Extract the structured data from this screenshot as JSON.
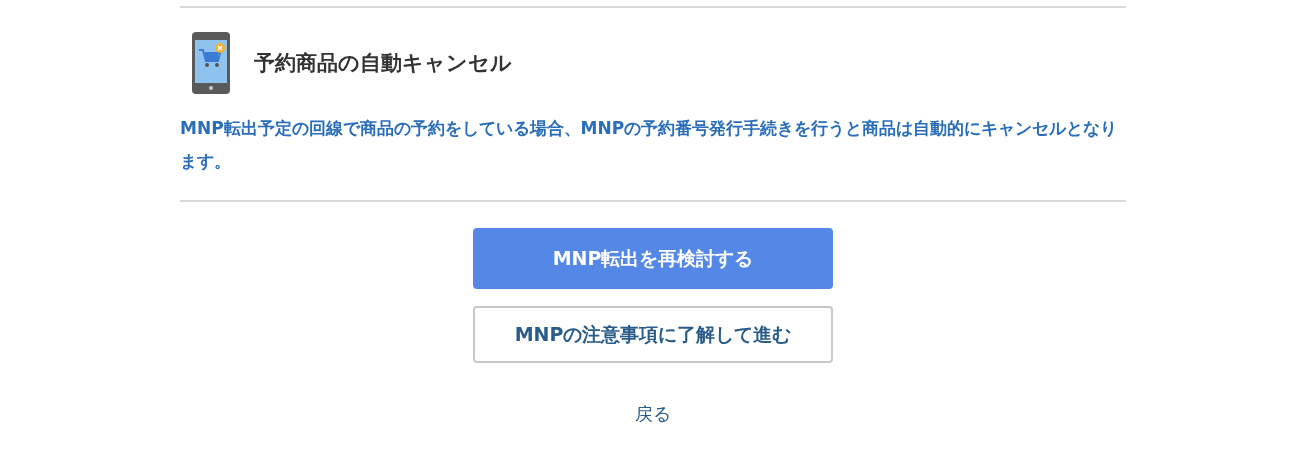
{
  "section": {
    "title": "予約商品の自動キャンセル",
    "description": "MNP転出予定の回線で商品の予約をしている場合、MNPの予約番号発行手続きを行うと商品は自動的にキャンセルとなります。"
  },
  "buttons": [
    {
      "label": "MNP転出を再検討する",
      "kind": "primary"
    },
    {
      "label": "MNPの注意事項に了解して進む",
      "kind": "secondary"
    }
  ],
  "back_link": "戻る"
}
